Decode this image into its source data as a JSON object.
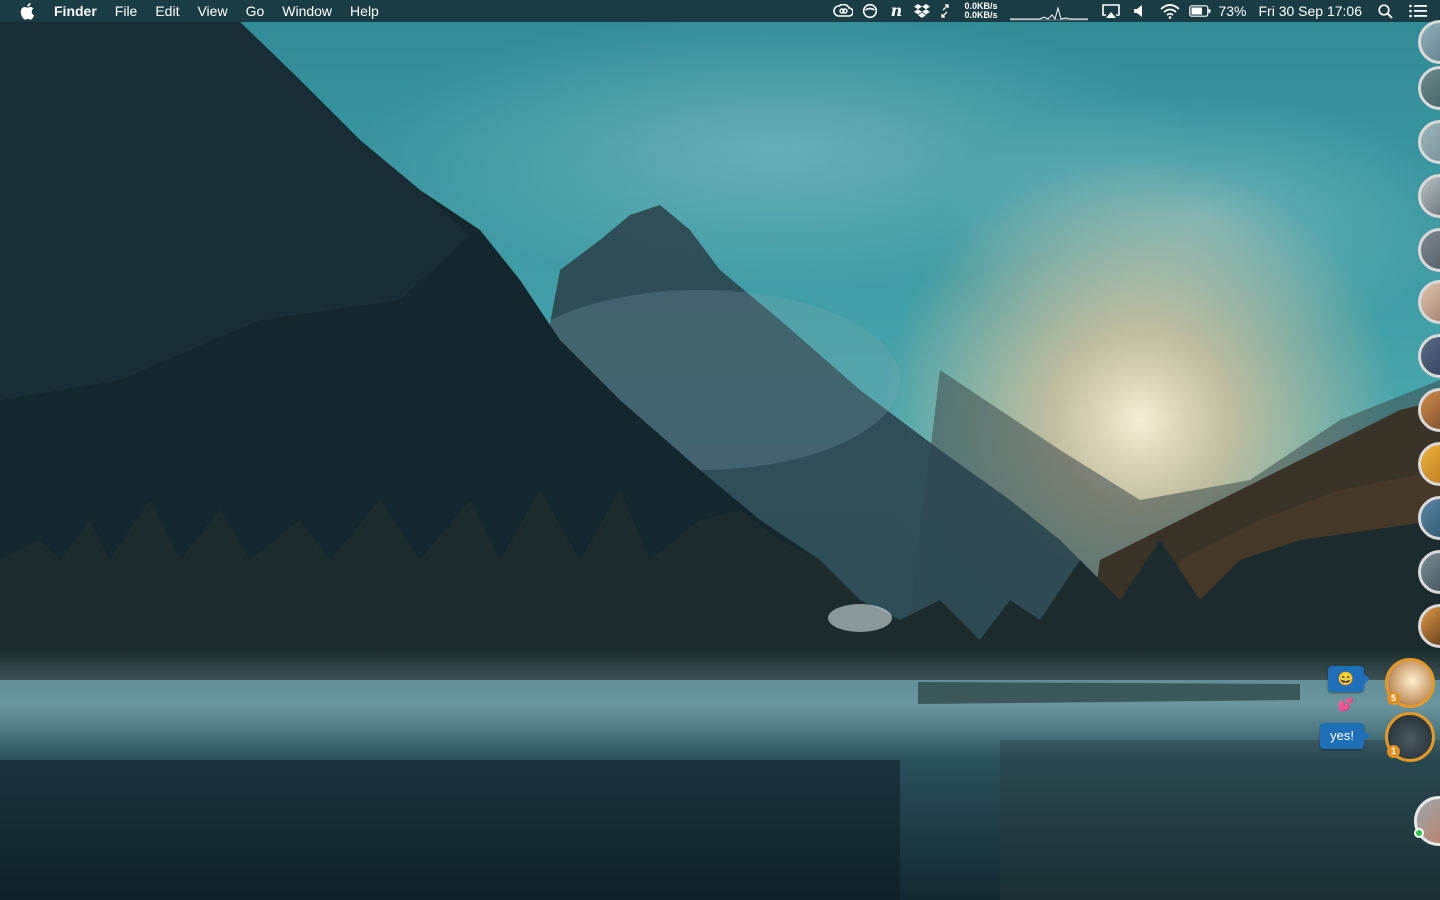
{
  "menubar": {
    "apple_icon": "apple-logo-icon",
    "app_name": "Finder",
    "menus": [
      "File",
      "Edit",
      "View",
      "Go",
      "Window",
      "Help"
    ],
    "status_icons": [
      "creative-cloud-icon",
      "sync-icon",
      "notion-n-icon",
      "dropbox-icon",
      "resize-arrows-icon"
    ],
    "network": {
      "upload": "0.0KB/s",
      "download": "0.0KB/s"
    },
    "system_icons": [
      "airplay-icon",
      "volume-icon",
      "wifi-icon",
      "battery-icon"
    ],
    "battery_percent": "73%",
    "clock": "Fri 30 Sep 17:06",
    "right_icons": [
      "spotlight-search-icon",
      "notification-center-icon"
    ]
  },
  "chat_heads": {
    "bubbles": [
      {
        "text": "😄💕",
        "badge": "5"
      },
      {
        "text": "yes!",
        "badge": "1"
      }
    ],
    "colors": {
      "active_ring": "#e39a2a",
      "bubble": "#1e6fb8",
      "online": "#29c24a"
    }
  }
}
